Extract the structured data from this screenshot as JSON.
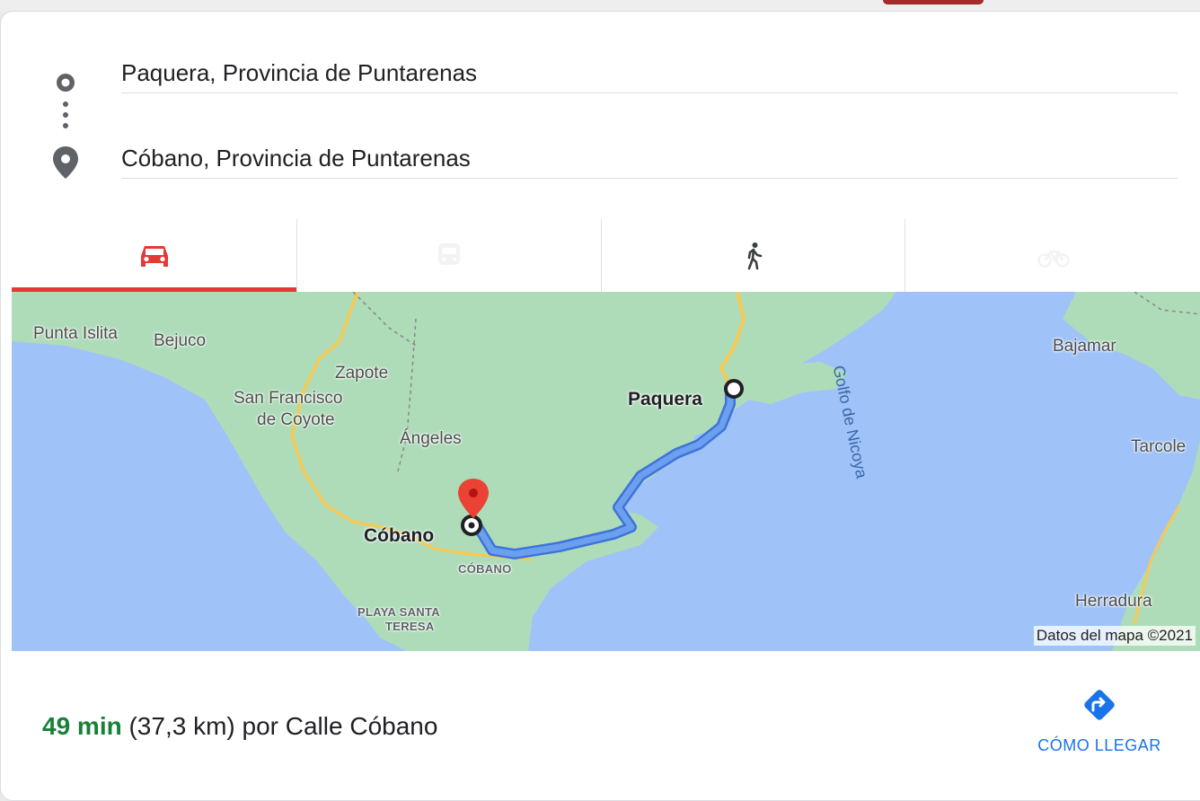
{
  "directions": {
    "origin": "Paquera, Provincia de Puntarenas",
    "destination": "Cóbano, Provincia de Puntarenas"
  },
  "travel_modes": [
    {
      "mode": "driving",
      "icon": "car-icon",
      "selected": true
    },
    {
      "mode": "transit",
      "icon": "train-icon",
      "selected": false
    },
    {
      "mode": "walking",
      "icon": "walk-icon",
      "selected": false
    },
    {
      "mode": "cycling",
      "icon": "bike-icon",
      "selected": false
    }
  ],
  "map": {
    "labels": {
      "punta_islita": "Punta Islita",
      "bejuco": "Bejuco",
      "zapote": "Zapote",
      "san_francisco_1": "San Francisco",
      "san_francisco_2": "de Coyote",
      "angeles": "Ángeles",
      "paquera": "Paquera",
      "cobano": "Cóbano",
      "cobano_district": "CÓBANO",
      "playa_santa_1": "PLAYA SANTA",
      "playa_santa_2": "TERESA",
      "golfo": "Golfo de Nicoya",
      "bajamar": "Bajamar",
      "tarcoles": "Tarcole",
      "herradura": "Herradura"
    },
    "attribution": "Datos del mapa ©2021",
    "colors": {
      "water": "#9fc3f8",
      "land": "#aedcb9",
      "route": "#6c9ff0",
      "route_outline": "#3d74d8",
      "destination_pin": "#ea4335"
    }
  },
  "route": {
    "duration": "49 min",
    "distance": "(37,3 km) por Calle Cóbano"
  },
  "action": {
    "label": "CÓMO LLEGAR",
    "icon": "directions-icon",
    "color": "#1a73e8"
  }
}
